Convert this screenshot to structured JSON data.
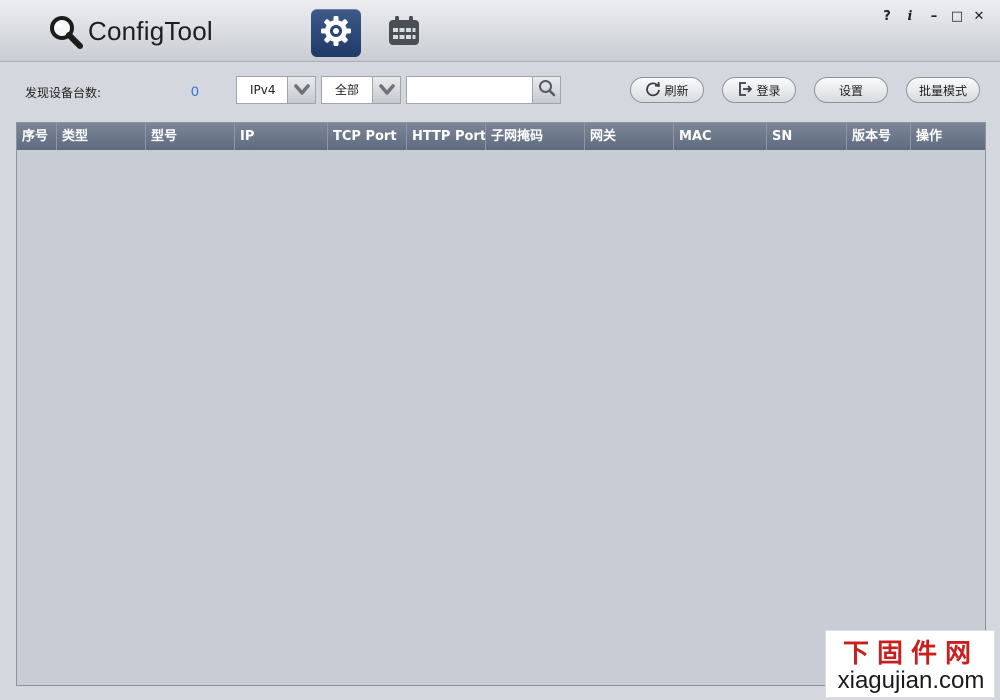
{
  "app": {
    "title": "ConfigTool"
  },
  "window_controls": {
    "help": "?",
    "info": "i",
    "minimize": "–",
    "maximize": "□",
    "close": "✕"
  },
  "toolbar": {
    "found_label": "发现设备台数:",
    "found_count": "0",
    "ip_version": {
      "value": "IPv4"
    },
    "filter": {
      "value": "全部"
    },
    "search": {
      "placeholder": "",
      "value": ""
    },
    "refresh_label": "刷新",
    "login_label": "登录",
    "settings_label": "设置",
    "batch_label": "批量模式"
  },
  "table": {
    "columns": [
      "序号",
      "类型",
      "型号",
      "IP",
      "TCP Port",
      "HTTP Port",
      "子网掩码",
      "网关",
      "MAC",
      "SN",
      "版本号",
      "操作"
    ],
    "rows": []
  },
  "watermark": {
    "cn": "下固件网",
    "en": "xiagujian.com"
  },
  "colors": {
    "accent": "#2d74d9",
    "header": "#68738a",
    "nav_active": "#2b4676"
  }
}
